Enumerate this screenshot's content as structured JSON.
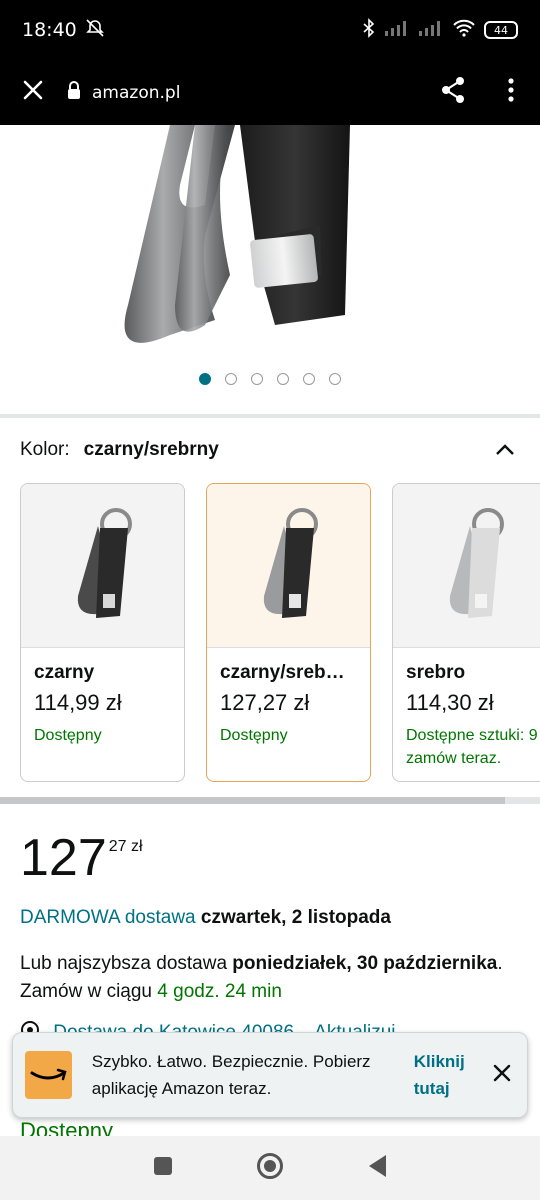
{
  "status_bar": {
    "time": "18:40",
    "battery": "44"
  },
  "browser": {
    "url": "amazon.pl"
  },
  "gallery": {
    "image_count": 6,
    "active_index": 0
  },
  "color_selector": {
    "label": "Kolor:",
    "selected": "czarny/srebrny"
  },
  "variants": [
    {
      "name": "czarny",
      "price": "114,99 zł",
      "availability": "Dostępny"
    },
    {
      "name": "czarny/srebrny",
      "name_display": "czarny/sreb…",
      "price": "127,27 zł",
      "availability": "Dostępny"
    },
    {
      "name": "srebro",
      "price": "114,30 zł",
      "availability": "Dostępne sztuki: 9 – zamów teraz."
    }
  ],
  "price": {
    "whole": "127",
    "fraction": "27",
    "currency": "zł"
  },
  "delivery": {
    "free_label": "DARMOWA dostawa",
    "free_date": "czwartek, 2 listopada",
    "fast_prefix": "Lub najszybsza dostawa",
    "fast_date": "poniedziałek, 30 października",
    "order_within_prefix": ". Zamów w ciągu",
    "order_within_time": "4 godz. 24 min"
  },
  "location": {
    "text": "Dostawa do Katowice 40086 – Aktualizuj"
  },
  "availability_main": "Dostępny",
  "toast": {
    "message": "Szybko. Łatwo. Bezpiecznie. Pobierz aplikację Amazon teraz.",
    "link": "Kliknij tutaj"
  },
  "colors": {
    "accent": "#007185",
    "green": "#007600",
    "selected_border": "#e3a65a"
  }
}
